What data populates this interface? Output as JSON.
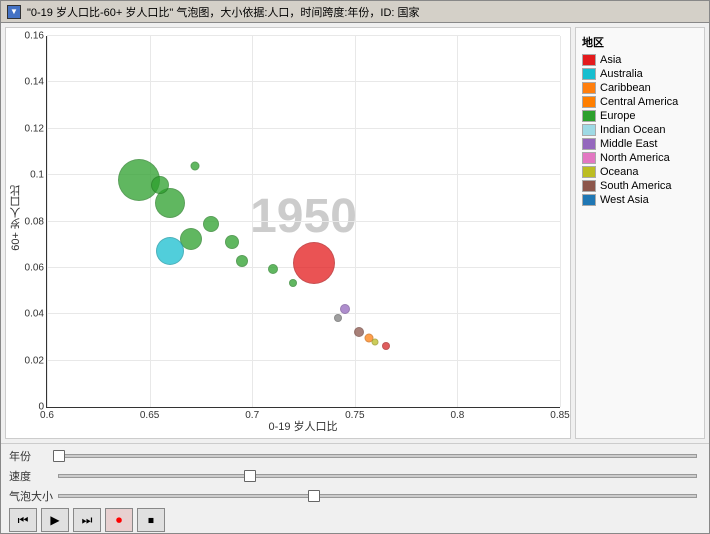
{
  "window": {
    "title": "\"0-19 岁人口比-60+ 岁人口比\" 气泡图，大小依据:人口，时间跨度:年份，ID: 国家"
  },
  "chart": {
    "year": "1950",
    "x_axis_label": "0-19 岁人口比",
    "y_axis_label": "60+ 岁人口比",
    "x_ticks": [
      "0.6",
      "0.65",
      "0.7",
      "0.75",
      "0.8",
      "0.85"
    ],
    "y_ticks": [
      "0",
      "0.02",
      "0.04",
      "0.06",
      "0.08",
      "0.1",
      "0.12",
      "0.14",
      "0.16"
    ],
    "bubbles": [
      {
        "x": 0.645,
        "y": 0.08,
        "r": 42,
        "color": "#2ca02c",
        "region": "Europe"
      },
      {
        "x": 0.66,
        "y": 0.075,
        "r": 30,
        "color": "#2ca02c",
        "region": "Europe"
      },
      {
        "x": 0.67,
        "y": 0.063,
        "r": 22,
        "color": "#2ca02c",
        "region": "Europe"
      },
      {
        "x": 0.66,
        "y": 0.055,
        "r": 28,
        "color": "#17becf",
        "region": "Australia"
      },
      {
        "x": 0.655,
        "y": 0.088,
        "r": 18,
        "color": "#2ca02c",
        "region": "Europe"
      },
      {
        "x": 0.672,
        "y": 0.1,
        "r": 9,
        "color": "#2ca02c",
        "region": "Europe"
      },
      {
        "x": 0.68,
        "y": 0.072,
        "r": 16,
        "color": "#2ca02c",
        "region": "Europe"
      },
      {
        "x": 0.69,
        "y": 0.065,
        "r": 14,
        "color": "#2ca02c",
        "region": "Europe"
      },
      {
        "x": 0.695,
        "y": 0.058,
        "r": 12,
        "color": "#2ca02c",
        "region": "Europe"
      },
      {
        "x": 0.71,
        "y": 0.055,
        "r": 10,
        "color": "#2ca02c",
        "region": "Europe"
      },
      {
        "x": 0.72,
        "y": 0.05,
        "r": 8,
        "color": "#2ca02c",
        "region": "Europe"
      },
      {
        "x": 0.73,
        "y": 0.044,
        "r": 42,
        "color": "#e31a1c",
        "region": "North America"
      },
      {
        "x": 0.745,
        "y": 0.038,
        "r": 10,
        "color": "#9467bd",
        "region": "Middle East"
      },
      {
        "x": 0.742,
        "y": 0.035,
        "r": 8,
        "color": "#7f7f7f",
        "region": "Oceana"
      },
      {
        "x": 0.752,
        "y": 0.028,
        "r": 10,
        "color": "#8c564b",
        "region": "South America"
      },
      {
        "x": 0.757,
        "y": 0.026,
        "r": 9,
        "color": "#ff7f0e",
        "region": "Caribbean"
      },
      {
        "x": 0.76,
        "y": 0.025,
        "r": 7,
        "color": "#bcbd22",
        "region": "West Asia"
      },
      {
        "x": 0.765,
        "y": 0.023,
        "r": 8,
        "color": "#d62728",
        "region": "Indian Ocean"
      }
    ]
  },
  "legend": {
    "title": "地区",
    "items": [
      {
        "label": "Asia",
        "color": "#e31a1c"
      },
      {
        "label": "Australia",
        "color": "#17becf"
      },
      {
        "label": "Caribbean",
        "color": "#ff7f0e"
      },
      {
        "label": "Central America",
        "color": "#ff7f00"
      },
      {
        "label": "Europe",
        "color": "#2ca02c"
      },
      {
        "label": "Indian Ocean",
        "color": "#9edae5"
      },
      {
        "label": "Middle East",
        "color": "#9467bd"
      },
      {
        "label": "North America",
        "color": "#e377c2"
      },
      {
        "label": "Oceana",
        "color": "#bcbd22"
      },
      {
        "label": "South America",
        "color": "#8c564b"
      },
      {
        "label": "West Asia",
        "color": "#1f77b4"
      }
    ]
  },
  "controls": {
    "year_label": "年份",
    "speed_label": "速度",
    "size_label": "气泡大小",
    "year_position": 0.0,
    "speed_position": 0.3,
    "size_position": 0.4,
    "buttons": [
      "⏮",
      "▶",
      "⏭",
      "⏺",
      "⏹"
    ]
  }
}
